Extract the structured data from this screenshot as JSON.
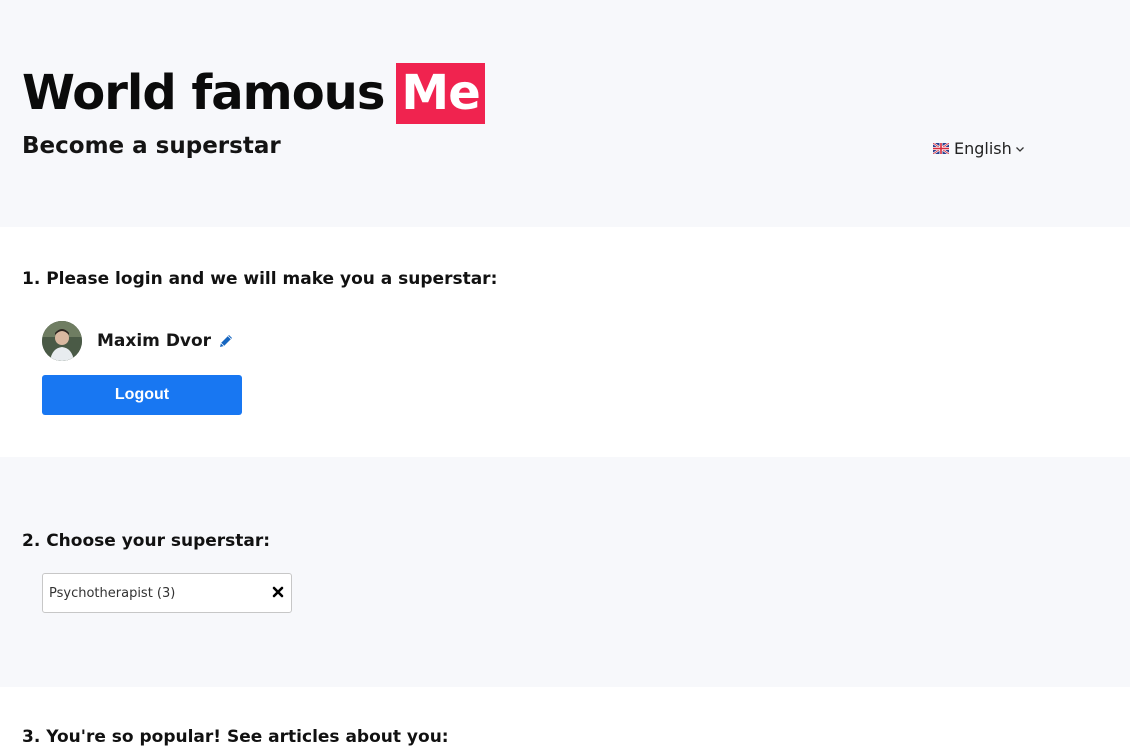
{
  "header": {
    "title_main": "World famous",
    "title_highlight": "Me",
    "tagline": "Become a superstar",
    "language": {
      "label": "English",
      "flag_icon": "uk-flag-icon",
      "chevron_icon": "chevron-down-icon"
    }
  },
  "colors": {
    "accent": "#f0234f",
    "primary_button": "#1877f2",
    "header_bg": "#f7f8fb",
    "edit_icon": "#1565c0"
  },
  "login_section": {
    "heading": "1. Please login and we will make you a superstar:",
    "user": {
      "name": "Maxim Dvor",
      "avatar_icon": "avatar",
      "edit_icon": "pencil-icon"
    },
    "logout_label": "Logout"
  },
  "choose_section": {
    "heading": "2. Choose your superstar:",
    "selected_value": "Psychotherapist (3)",
    "clear_icon": "close-icon"
  },
  "articles_section": {
    "heading": "3. You're so popular! See articles about you:"
  }
}
